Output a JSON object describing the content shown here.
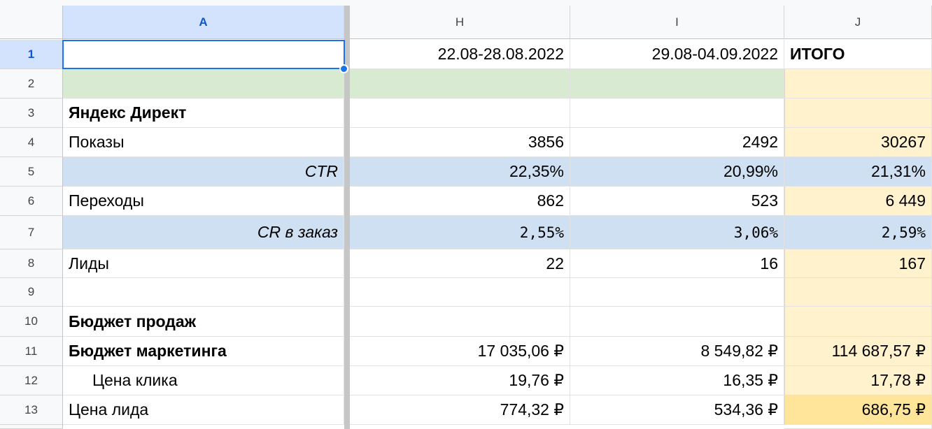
{
  "columns": [
    "A",
    "H",
    "I",
    "J"
  ],
  "rows": [
    {
      "num": "1",
      "a": "",
      "h": "22.08-28.08.2022",
      "i": "29.08-04.09.2022",
      "j": "ИТОГО"
    },
    {
      "num": "2",
      "a": "",
      "h": "",
      "i": "",
      "j": ""
    },
    {
      "num": "3",
      "a": "Яндекс Директ",
      "h": "",
      "i": "",
      "j": ""
    },
    {
      "num": "4",
      "a": "Показы",
      "h": "3856",
      "i": "2492",
      "j": "30267"
    },
    {
      "num": "5",
      "a": "CTR",
      "h": "22,35%",
      "i": "20,99%",
      "j": "21,31%"
    },
    {
      "num": "6",
      "a": "Переходы",
      "h": "862",
      "i": "523",
      "j": "6 449"
    },
    {
      "num": "7",
      "a": "CR в заказ",
      "h": "2,55%",
      "i": "3,06%",
      "j": "2,59%"
    },
    {
      "num": "8",
      "a": "Лиды",
      "h": "22",
      "i": "16",
      "j": "167"
    },
    {
      "num": "9",
      "a": "",
      "h": "",
      "i": "",
      "j": ""
    },
    {
      "num": "10",
      "a": "Бюджет продаж",
      "h": "",
      "i": "",
      "j": ""
    },
    {
      "num": "11",
      "a": "Бюджет маркетинга",
      "h": "17 035,06 ₽",
      "i": "8 549,82 ₽",
      "j": "114 687,57 ₽"
    },
    {
      "num": "12",
      "a": "Цена клика",
      "h": "19,76 ₽",
      "i": "16,35 ₽",
      "j": "17,78 ₽"
    },
    {
      "num": "13",
      "a": "Цена лида",
      "h": "774,32 ₽",
      "i": "534,36 ₽",
      "j": "686,75 ₽"
    }
  ],
  "colors": {
    "selection": "#1a73e8",
    "header_selected": "#d3e3fd",
    "row_blue": "#cfe0f3",
    "row_green": "#d9ead3",
    "total_yellow": "#fff2cc",
    "total_highlight": "#ffe599"
  }
}
